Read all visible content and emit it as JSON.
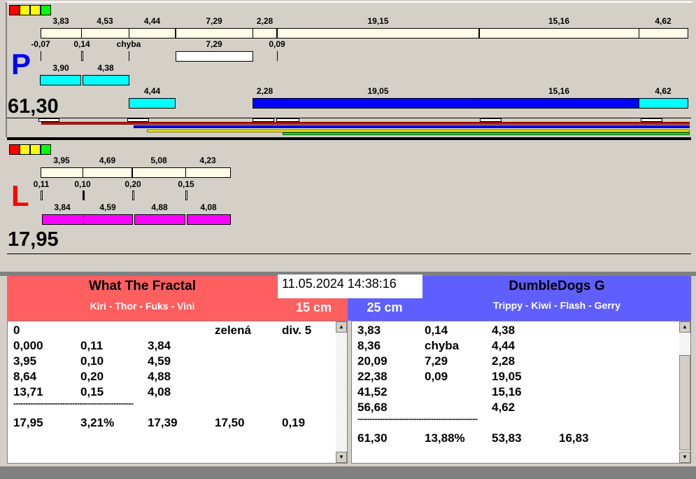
{
  "status_colors": [
    "#ff0000",
    "#ffff00",
    "#ffff00",
    "#00ff00"
  ],
  "p_panel": {
    "letter": "P",
    "total": "61,30",
    "top_values": [
      "3,83",
      "4,53",
      "4,44",
      "7,29",
      "2,28",
      "19,15",
      "15,16",
      "4,62"
    ],
    "marker_values": [
      "-0,07",
      "0,14",
      "chyba",
      "7,29",
      "0,09"
    ],
    "cyan_values": [
      "3,90",
      "4,38"
    ],
    "bottom_values": [
      "4,44",
      "2,28",
      "19,05",
      "15,16",
      "4,62"
    ]
  },
  "l_panel": {
    "letter": "L",
    "total": "17,95",
    "top_values": [
      "3,95",
      "4,69",
      "5,08",
      "4,23"
    ],
    "marker_values": [
      "0,11",
      "0,10",
      "0,20",
      "0,15"
    ],
    "magenta_values": [
      "3,84",
      "4,59",
      "4,88",
      "4,08"
    ]
  },
  "datetime": "11.05.2024 14:38:16",
  "left_team": {
    "name": "What The Fractal",
    "members": "Kiri - Thor - Fuks - Vini",
    "distance": "15 cm",
    "color": "#ff5f5f",
    "rows": [
      [
        "0",
        "",
        "",
        "zelená",
        "div. 5"
      ],
      [
        "0,000",
        "0,11",
        "3,84",
        "",
        ""
      ],
      [
        "3,95",
        "0,10",
        "4,59",
        "",
        ""
      ],
      [
        "8,64",
        "0,20",
        "4,88",
        "",
        ""
      ],
      [
        "13,71",
        "0,15",
        "4,08",
        "",
        ""
      ]
    ],
    "separator": "-------------------------------------------------",
    "summary": [
      "17,95",
      "3,21%",
      "17,39",
      "17,50",
      "0,19"
    ]
  },
  "right_team": {
    "name": "DumbleDogs G",
    "members": "Trippy - Kiwi - Flash - Gerry",
    "distance": "25 cm",
    "color": "#5f5fff",
    "rows": [
      [
        "3,83",
        "0,14",
        "4,38"
      ],
      [
        "8,36",
        "chyba",
        "4,44"
      ],
      [
        "20,09",
        "7,29",
        "2,28"
      ],
      [
        "22,38",
        "0,09",
        "19,05"
      ],
      [
        "41,52",
        "",
        "15,16"
      ],
      [
        "56,68",
        "",
        "4,62"
      ]
    ],
    "separator": "-------------------------------------------------",
    "summary": [
      "61,30",
      "13,88%",
      "53,83",
      "16,83"
    ]
  }
}
